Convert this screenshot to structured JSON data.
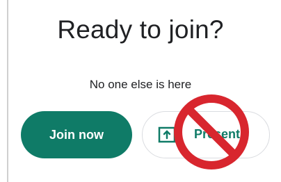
{
  "heading": {
    "title": "Ready to join?",
    "status": "No one else is here"
  },
  "actions": {
    "join_label": "Join now",
    "present_label": "Present"
  },
  "colors": {
    "accent": "#0f7b67",
    "prohibition": "#d8262e"
  },
  "icons": {
    "present": "present-screen-icon",
    "overlay": "no-entry-sign-icon"
  }
}
